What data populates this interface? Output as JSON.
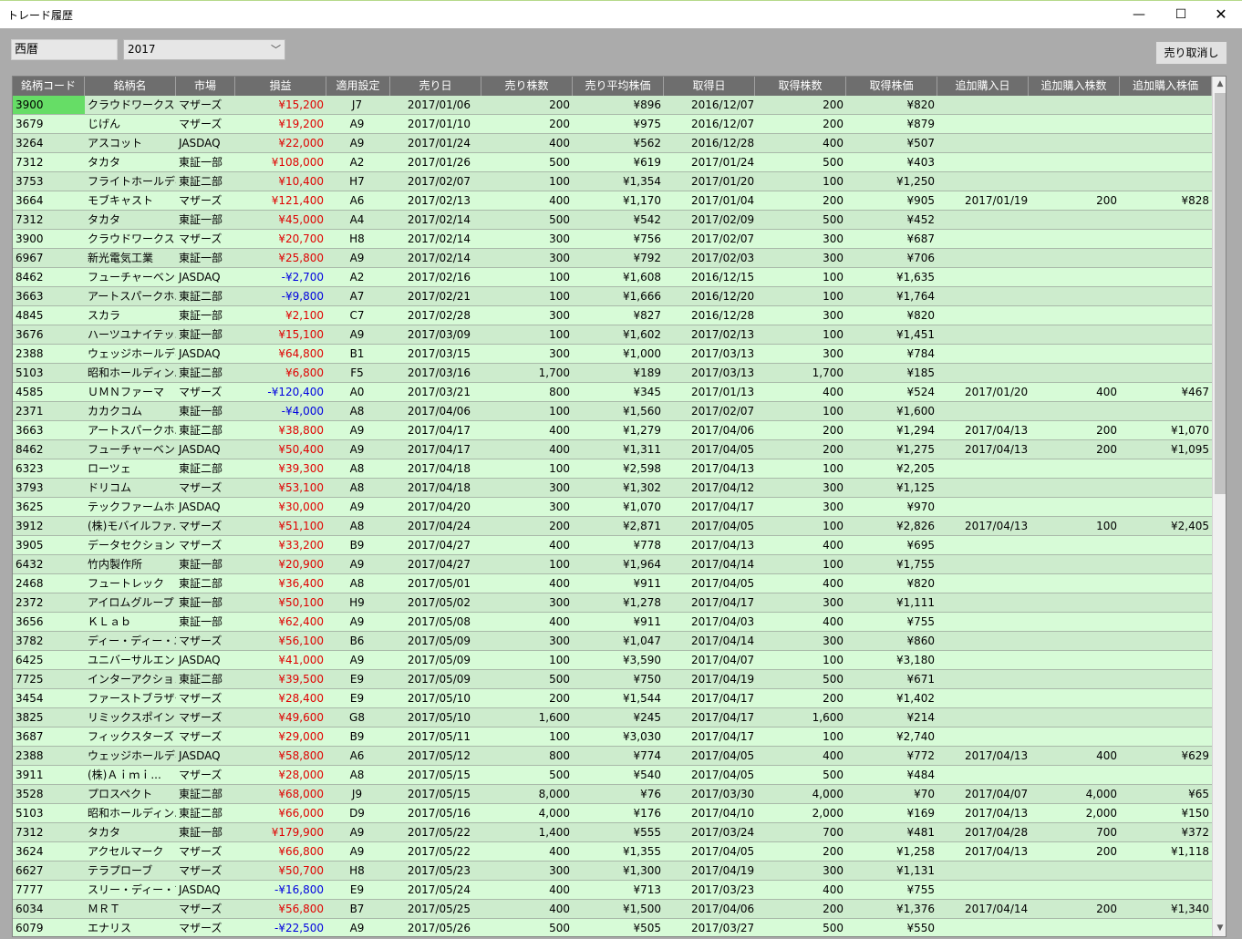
{
  "window": {
    "title": "トレード履歴",
    "min": "—",
    "max": "☐",
    "close": "✕"
  },
  "toolbar": {
    "calendar_label": "西暦",
    "year": "2017",
    "cancel_label": "売り取消し"
  },
  "columns": [
    "銘柄コード",
    "銘柄名",
    "市場",
    "損益",
    "適用設定",
    "売り日",
    "売り株数",
    "売り平均株価",
    "取得日",
    "取得株数",
    "取得株価",
    "追加購入日",
    "追加購入株数",
    "追加購入株価"
  ],
  "rows": [
    [
      "3900",
      "クラウドワークス",
      "マザーズ",
      "¥15,200",
      "J7",
      "2017/01/06",
      "200",
      "¥896",
      "2016/12/07",
      "200",
      "¥820",
      "",
      "",
      ""
    ],
    [
      "3679",
      "じげん",
      "マザーズ",
      "¥19,200",
      "A9",
      "2017/01/10",
      "200",
      "¥975",
      "2016/12/07",
      "200",
      "¥879",
      "",
      "",
      ""
    ],
    [
      "3264",
      "アスコット",
      "JASDAQ",
      "¥22,000",
      "A9",
      "2017/01/24",
      "400",
      "¥562",
      "2016/12/28",
      "400",
      "¥507",
      "",
      "",
      ""
    ],
    [
      "7312",
      "タカタ",
      "東証一部",
      "¥108,000",
      "A2",
      "2017/01/26",
      "500",
      "¥619",
      "2017/01/24",
      "500",
      "¥403",
      "",
      "",
      ""
    ],
    [
      "3753",
      "フライトホールディ...",
      "東証二部",
      "¥10,400",
      "H7",
      "2017/02/07",
      "100",
      "¥1,354",
      "2017/01/20",
      "100",
      "¥1,250",
      "",
      "",
      ""
    ],
    [
      "3664",
      "モブキャスト",
      "マザーズ",
      "¥121,400",
      "A6",
      "2017/02/13",
      "400",
      "¥1,170",
      "2017/01/04",
      "200",
      "¥905",
      "2017/01/19",
      "200",
      "¥828"
    ],
    [
      "7312",
      "タカタ",
      "東証一部",
      "¥45,000",
      "A4",
      "2017/02/14",
      "500",
      "¥542",
      "2017/02/09",
      "500",
      "¥452",
      "",
      "",
      ""
    ],
    [
      "3900",
      "クラウドワークス",
      "マザーズ",
      "¥20,700",
      "H8",
      "2017/02/14",
      "300",
      "¥756",
      "2017/02/07",
      "300",
      "¥687",
      "",
      "",
      ""
    ],
    [
      "6967",
      "新光電気工業",
      "東証一部",
      "¥25,800",
      "A9",
      "2017/02/14",
      "300",
      "¥792",
      "2017/02/03",
      "300",
      "¥706",
      "",
      "",
      ""
    ],
    [
      "8462",
      "フューチャーベンチ...",
      "JASDAQ",
      "-¥2,700",
      "A2",
      "2017/02/16",
      "100",
      "¥1,608",
      "2016/12/15",
      "100",
      "¥1,635",
      "",
      "",
      ""
    ],
    [
      "3663",
      "アートスパークホ...",
      "東証二部",
      "-¥9,800",
      "A7",
      "2017/02/21",
      "100",
      "¥1,666",
      "2016/12/20",
      "100",
      "¥1,764",
      "",
      "",
      ""
    ],
    [
      "4845",
      "スカラ",
      "東証一部",
      "¥2,100",
      "C7",
      "2017/02/28",
      "300",
      "¥827",
      "2016/12/28",
      "300",
      "¥820",
      "",
      "",
      ""
    ],
    [
      "3676",
      "ハーツユナイテッ...",
      "東証一部",
      "¥15,100",
      "A9",
      "2017/03/09",
      "100",
      "¥1,602",
      "2017/02/13",
      "100",
      "¥1,451",
      "",
      "",
      ""
    ],
    [
      "2388",
      "ウェッジホールディ...",
      "JASDAQ",
      "¥64,800",
      "B1",
      "2017/03/15",
      "300",
      "¥1,000",
      "2017/03/13",
      "300",
      "¥784",
      "",
      "",
      ""
    ],
    [
      "5103",
      "昭和ホールディン...",
      "東証二部",
      "¥6,800",
      "F5",
      "2017/03/16",
      "1,700",
      "¥189",
      "2017/03/13",
      "1,700",
      "¥185",
      "",
      "",
      ""
    ],
    [
      "4585",
      "ＵＭＮファーマ",
      "マザーズ",
      "-¥120,400",
      "A0",
      "2017/03/21",
      "800",
      "¥345",
      "2017/01/13",
      "400",
      "¥524",
      "2017/01/20",
      "400",
      "¥467"
    ],
    [
      "2371",
      "カカクコム",
      "東証一部",
      "-¥4,000",
      "A8",
      "2017/04/06",
      "100",
      "¥1,560",
      "2017/02/07",
      "100",
      "¥1,600",
      "",
      "",
      ""
    ],
    [
      "3663",
      "アートスパークホ...",
      "東証二部",
      "¥38,800",
      "A9",
      "2017/04/17",
      "400",
      "¥1,279",
      "2017/04/06",
      "200",
      "¥1,294",
      "2017/04/13",
      "200",
      "¥1,070"
    ],
    [
      "8462",
      "フューチャーベンチ...",
      "JASDAQ",
      "¥50,400",
      "A9",
      "2017/04/17",
      "400",
      "¥1,311",
      "2017/04/05",
      "200",
      "¥1,275",
      "2017/04/13",
      "200",
      "¥1,095"
    ],
    [
      "6323",
      "ローツェ",
      "東証二部",
      "¥39,300",
      "A8",
      "2017/04/18",
      "100",
      "¥2,598",
      "2017/04/13",
      "100",
      "¥2,205",
      "",
      "",
      ""
    ],
    [
      "3793",
      "ドリコム",
      "マザーズ",
      "¥53,100",
      "A8",
      "2017/04/18",
      "300",
      "¥1,302",
      "2017/04/12",
      "300",
      "¥1,125",
      "",
      "",
      ""
    ],
    [
      "3625",
      "テックファームホー...",
      "JASDAQ",
      "¥30,000",
      "A9",
      "2017/04/20",
      "300",
      "¥1,070",
      "2017/04/17",
      "300",
      "¥970",
      "",
      "",
      ""
    ],
    [
      "3912",
      "(株)モバイルファ...",
      "マザーズ",
      "¥51,100",
      "A8",
      "2017/04/24",
      "200",
      "¥2,871",
      "2017/04/05",
      "100",
      "¥2,826",
      "2017/04/13",
      "100",
      "¥2,405"
    ],
    [
      "3905",
      "データセクション",
      "マザーズ",
      "¥33,200",
      "B9",
      "2017/04/27",
      "400",
      "¥778",
      "2017/04/13",
      "400",
      "¥695",
      "",
      "",
      ""
    ],
    [
      "6432",
      "竹内製作所",
      "東証一部",
      "¥20,900",
      "A9",
      "2017/04/27",
      "100",
      "¥1,964",
      "2017/04/14",
      "100",
      "¥1,755",
      "",
      "",
      ""
    ],
    [
      "2468",
      "フュートレック",
      "東証二部",
      "¥36,400",
      "A8",
      "2017/05/01",
      "400",
      "¥911",
      "2017/04/05",
      "400",
      "¥820",
      "",
      "",
      ""
    ],
    [
      "2372",
      "アイロムグループ",
      "東証一部",
      "¥50,100",
      "H9",
      "2017/05/02",
      "300",
      "¥1,278",
      "2017/04/17",
      "300",
      "¥1,111",
      "",
      "",
      ""
    ],
    [
      "3656",
      "ＫＬａｂ",
      "東証一部",
      "¥62,400",
      "A9",
      "2017/05/08",
      "400",
      "¥911",
      "2017/04/03",
      "400",
      "¥755",
      "",
      "",
      ""
    ],
    [
      "3782",
      "ディー・ディー・エス",
      "マザーズ",
      "¥56,100",
      "B6",
      "2017/05/09",
      "300",
      "¥1,047",
      "2017/04/14",
      "300",
      "¥860",
      "",
      "",
      ""
    ],
    [
      "6425",
      "ユニバーサルエン...",
      "JASDAQ",
      "¥41,000",
      "A9",
      "2017/05/09",
      "100",
      "¥3,590",
      "2017/04/07",
      "100",
      "¥3,180",
      "",
      "",
      ""
    ],
    [
      "7725",
      "インターアクション",
      "東証二部",
      "¥39,500",
      "E9",
      "2017/05/09",
      "500",
      "¥750",
      "2017/04/19",
      "500",
      "¥671",
      "",
      "",
      ""
    ],
    [
      "3454",
      "ファーストブラザーズ",
      "マザーズ",
      "¥28,400",
      "E9",
      "2017/05/10",
      "200",
      "¥1,544",
      "2017/04/17",
      "200",
      "¥1,402",
      "",
      "",
      ""
    ],
    [
      "3825",
      "リミックスポイント",
      "マザーズ",
      "¥49,600",
      "G8",
      "2017/05/10",
      "1,600",
      "¥245",
      "2017/04/17",
      "1,600",
      "¥214",
      "",
      "",
      ""
    ],
    [
      "3687",
      "フィックスターズ",
      "マザーズ",
      "¥29,000",
      "B9",
      "2017/05/11",
      "100",
      "¥3,030",
      "2017/04/17",
      "100",
      "¥2,740",
      "",
      "",
      ""
    ],
    [
      "2388",
      "ウェッジホールディ...",
      "JASDAQ",
      "¥58,800",
      "A6",
      "2017/05/12",
      "800",
      "¥774",
      "2017/04/05",
      "400",
      "¥772",
      "2017/04/13",
      "400",
      "¥629"
    ],
    [
      "3911",
      "(株)Ａｉｍｉ...",
      "マザーズ",
      "¥28,000",
      "A8",
      "2017/05/15",
      "500",
      "¥540",
      "2017/04/05",
      "500",
      "¥484",
      "",
      "",
      ""
    ],
    [
      "3528",
      "プロスペクト",
      "東証二部",
      "¥68,000",
      "J9",
      "2017/05/15",
      "8,000",
      "¥76",
      "2017/03/30",
      "4,000",
      "¥70",
      "2017/04/07",
      "4,000",
      "¥65"
    ],
    [
      "5103",
      "昭和ホールディン...",
      "東証二部",
      "¥66,000",
      "D9",
      "2017/05/16",
      "4,000",
      "¥176",
      "2017/04/10",
      "2,000",
      "¥169",
      "2017/04/13",
      "2,000",
      "¥150"
    ],
    [
      "7312",
      "タカタ",
      "東証一部",
      "¥179,900",
      "A9",
      "2017/05/22",
      "1,400",
      "¥555",
      "2017/03/24",
      "700",
      "¥481",
      "2017/04/28",
      "700",
      "¥372"
    ],
    [
      "3624",
      "アクセルマーク",
      "マザーズ",
      "¥66,800",
      "A9",
      "2017/05/22",
      "400",
      "¥1,355",
      "2017/04/05",
      "200",
      "¥1,258",
      "2017/04/13",
      "200",
      "¥1,118"
    ],
    [
      "6627",
      "テラプローブ",
      "マザーズ",
      "¥50,700",
      "H8",
      "2017/05/23",
      "300",
      "¥1,300",
      "2017/04/19",
      "300",
      "¥1,131",
      "",
      "",
      ""
    ],
    [
      "7777",
      "スリー・ディー・マ...",
      "JASDAQ",
      "-¥16,800",
      "E9",
      "2017/05/24",
      "400",
      "¥713",
      "2017/03/23",
      "400",
      "¥755",
      "",
      "",
      ""
    ],
    [
      "6034",
      "ＭＲＴ",
      "マザーズ",
      "¥56,800",
      "B7",
      "2017/05/25",
      "400",
      "¥1,500",
      "2017/04/06",
      "200",
      "¥1,376",
      "2017/04/14",
      "200",
      "¥1,340"
    ],
    [
      "6079",
      "エナリス",
      "マザーズ",
      "-¥22,500",
      "A9",
      "2017/05/26",
      "500",
      "¥505",
      "2017/03/27",
      "500",
      "¥550",
      "",
      "",
      ""
    ]
  ]
}
